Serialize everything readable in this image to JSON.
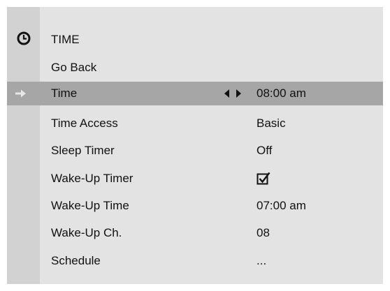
{
  "menu": {
    "title": "TIME",
    "title_icon": "clock-icon",
    "go_back_label": "Go Back",
    "items": [
      {
        "label": "Time",
        "value": "08:00 am",
        "selected": true
      },
      {
        "label": "Time Access",
        "value": "Basic"
      },
      {
        "label": "Sleep Timer",
        "value": "Off"
      },
      {
        "label": "Wake-Up Timer",
        "value": "",
        "value_icon": "checked-checkbox-icon",
        "checked": true
      },
      {
        "label": "Wake-Up Time",
        "value": "07:00 am"
      },
      {
        "label": "Wake-Up Ch.",
        "value": "08"
      },
      {
        "label": "Schedule",
        "value": "..."
      }
    ]
  },
  "colors": {
    "panel": "#e3e3e3",
    "strip": "#d2d2d2",
    "selected_row": "#a6a6a6",
    "text": "#111111"
  }
}
